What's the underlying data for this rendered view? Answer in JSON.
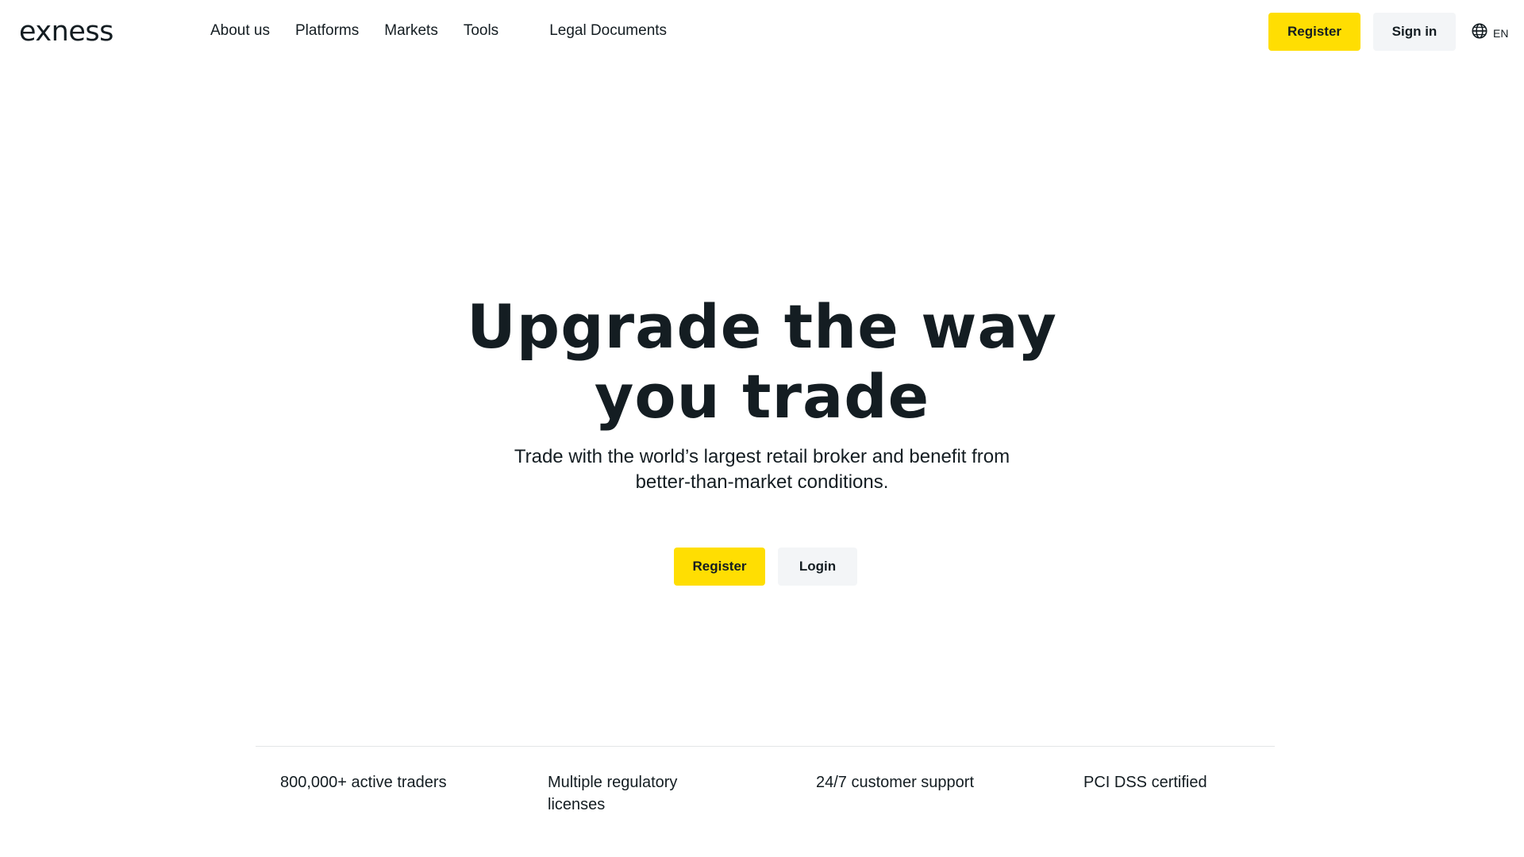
{
  "header": {
    "logo_text": "exness",
    "nav": [
      "About us",
      "Platforms",
      "Markets",
      "Tools",
      "Legal Documents"
    ],
    "register_label": "Register",
    "signin_label": "Sign in",
    "language": "EN"
  },
  "hero": {
    "title": "Upgrade the way you trade",
    "subtitle": "Trade with the world’s largest retail broker and benefit from better-than-market conditions.",
    "register_label": "Register",
    "login_label": "Login"
  },
  "features": [
    "800,000+ active traders",
    "Multiple regulatory licenses",
    "24/7 customer support",
    "PCI DSS certified"
  ],
  "colors": {
    "accent": "#ffde02",
    "text": "#141d22",
    "secondary_button": "#f3f5f7",
    "divider": "#e3e5e7"
  },
  "icons": {
    "language": "globe-icon"
  }
}
